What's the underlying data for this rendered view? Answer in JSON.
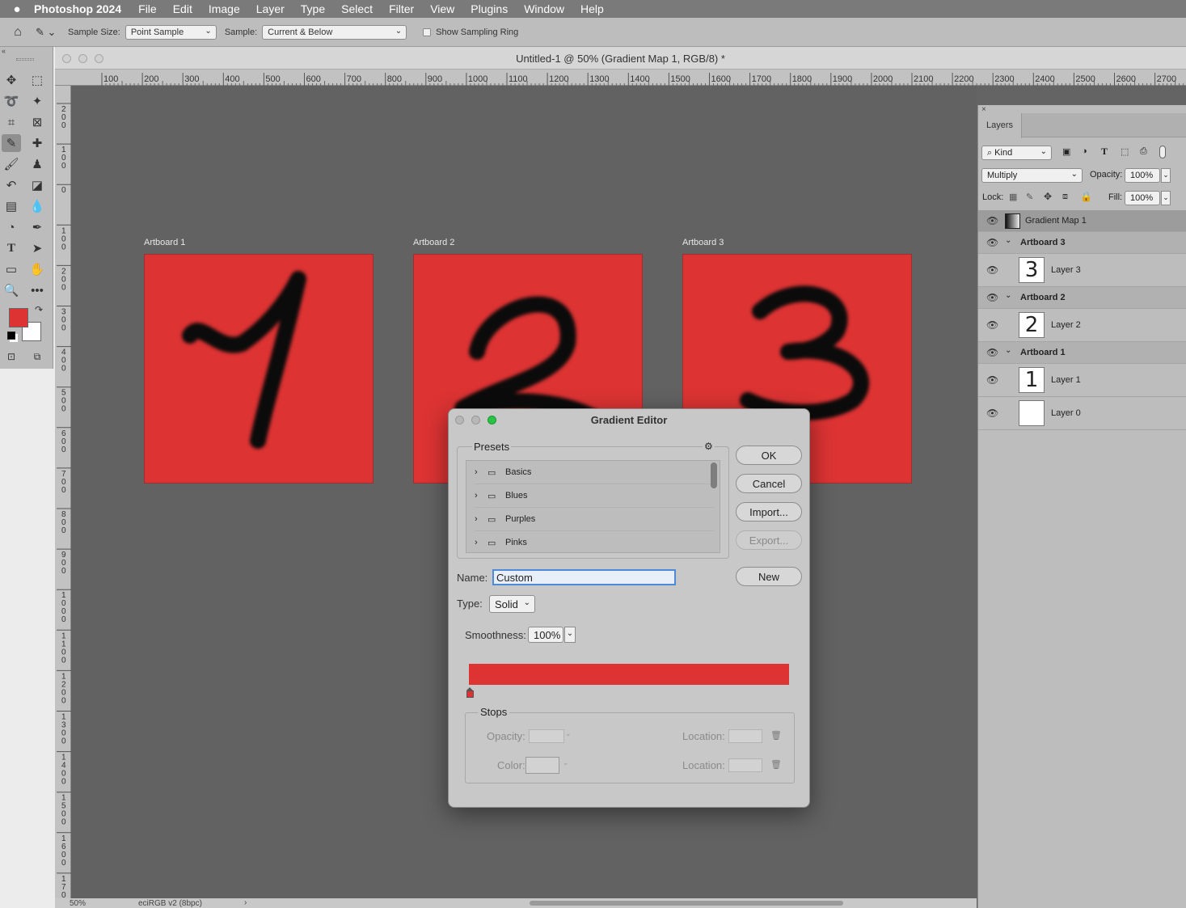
{
  "menubar": {
    "app_name": "Photoshop 2024",
    "items": [
      "File",
      "Edit",
      "Image",
      "Layer",
      "Type",
      "Select",
      "Filter",
      "View",
      "Plugins",
      "Window",
      "Help"
    ]
  },
  "options_bar": {
    "sample_size_label": "Sample Size:",
    "sample_size_value": "Point Sample",
    "sample_label": "Sample:",
    "sample_value": "Current & Below",
    "show_ring_label": "Show Sampling Ring",
    "show_ring_checked": false
  },
  "document": {
    "title": "Untitled-1 @ 50% (Gradient Map 1, RGB/8) *",
    "zoom": "50%",
    "profile": "eciRGB v2 (8bpc)"
  },
  "rulers": {
    "h_ticks": [
      "100",
      "200",
      "300",
      "400",
      "500",
      "600",
      "700",
      "800",
      "900",
      "1000",
      "1100",
      "1200",
      "1300",
      "1400",
      "1500",
      "1600",
      "1700",
      "1800",
      "1900",
      "2000",
      "2100",
      "2200",
      "2300",
      "2400",
      "2500",
      "2600",
      "2700"
    ],
    "v_ticks": [
      "2\n0\n0",
      "1\n0\n0",
      "0",
      "1\n0\n0",
      "2\n0\n0",
      "3\n0\n0",
      "4\n0\n0",
      "5\n0\n0",
      "6\n0\n0",
      "7\n0\n0",
      "8\n0\n0",
      "9\n0\n0",
      "1\n0\n0\n0",
      "1\n1\n0\n0",
      "1\n2\n0\n0",
      "1\n3\n0\n0",
      "1\n4\n0\n0",
      "1\n5\n0\n0",
      "1\n6\n0\n0",
      "1\n7\n0\n0"
    ]
  },
  "artboards": [
    {
      "label": "Artboard 1",
      "glyph": "1"
    },
    {
      "label": "Artboard 2",
      "glyph": "2"
    },
    {
      "label": "Artboard 3",
      "glyph": "3"
    }
  ],
  "colors": {
    "foreground": "#dd3333",
    "background": "#ffffff",
    "artboard_fill": "#dd3333",
    "gradient": "#dd3333"
  },
  "layers_panel": {
    "tab": "Layers",
    "filter_kind": "Kind",
    "blend_mode": "Multiply",
    "opacity_label": "Opacity:",
    "opacity_value": "100%",
    "lock_label": "Lock:",
    "fill_label": "Fill:",
    "fill_value": "100%",
    "layers": [
      {
        "name": "Gradient Map 1",
        "type": "adjustment"
      },
      {
        "name": "Artboard 3",
        "type": "group"
      },
      {
        "name": "Layer 3",
        "type": "layer",
        "glyph": "3"
      },
      {
        "name": "Artboard 2",
        "type": "group"
      },
      {
        "name": "Layer 2",
        "type": "layer",
        "glyph": "2"
      },
      {
        "name": "Artboard 1",
        "type": "group"
      },
      {
        "name": "Layer 1",
        "type": "layer",
        "glyph": "1"
      },
      {
        "name": "Layer 0",
        "type": "layer",
        "glyph": ""
      }
    ]
  },
  "gradient_editor": {
    "title": "Gradient Editor",
    "presets_label": "Presets",
    "presets": [
      "Basics",
      "Blues",
      "Purples",
      "Pinks"
    ],
    "buttons": {
      "ok": "OK",
      "cancel": "Cancel",
      "import": "Import...",
      "export": "Export...",
      "new": "New"
    },
    "name_label": "Name:",
    "name_value": "Custom",
    "type_label": "Type:",
    "type_value": "Solid",
    "smoothness_label": "Smoothness:",
    "smoothness_value": "100%",
    "stops_label": "Stops",
    "opacity_label": "Opacity:",
    "location_label": "Location:",
    "color_label": "Color:",
    "location2_label": "Location:"
  }
}
